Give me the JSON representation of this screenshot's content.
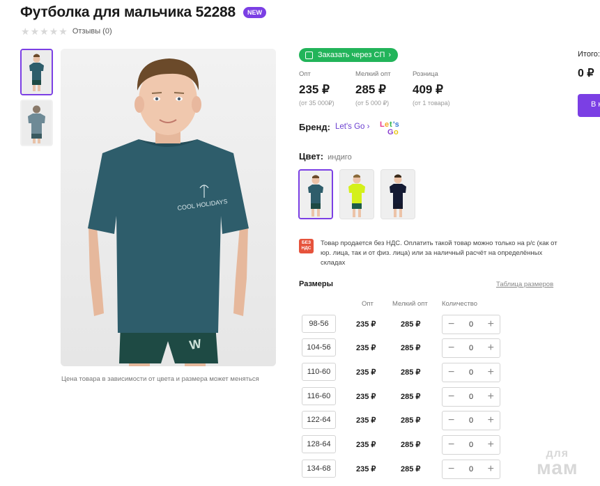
{
  "product": {
    "title": "Футболка для мальчика 52288",
    "badge": "NEW",
    "rating_stars": 0,
    "reviews_label": "Отзывы (0)",
    "caption": "Цена товара в зависимости от цвета и размера может меняться",
    "images": [
      "indigo-front",
      "indigo-back"
    ]
  },
  "order_button": {
    "label": "Заказать через СП"
  },
  "prices": [
    {
      "label": "Опт",
      "value": "235 ₽",
      "note": "(от 35 000₽)"
    },
    {
      "label": "Мелкий опт",
      "value": "285 ₽",
      "note": "(от 5 000 ₽)"
    },
    {
      "label": "Розница",
      "value": "409 ₽",
      "note": "(от 1 товара)"
    }
  ],
  "brand": {
    "label": "Бренд:",
    "name": "Let's Go",
    "logo_text": "Let's Go"
  },
  "color": {
    "label": "Цвет:",
    "value": "индиго",
    "swatches": [
      {
        "name": "indigo",
        "shirt": "#2e5d6b",
        "shorts": "#1e4a44"
      },
      {
        "name": "lime",
        "shirt": "#d4f01a",
        "shorts": "#1c5c4a"
      },
      {
        "name": "navy",
        "shirt": "#141a33",
        "shorts": "#14182c"
      }
    ]
  },
  "vat": {
    "icon_text_1": "БЕЗ",
    "icon_text_2": "НДС",
    "text": "Товар продается без НДС. Оплатить такой товар можно только на р/с (как от юр. лица, так и от физ. лица) или за наличный расчёт на определённых складах"
  },
  "sizes": {
    "title": "Размеры",
    "table_link": "Таблица размеров",
    "headers": {
      "opt": "Опт",
      "small": "Мелкий опт",
      "qty": "Количество"
    },
    "rows": [
      {
        "size": "98-56",
        "opt": "235 ₽",
        "small": "285 ₽",
        "qty": "0"
      },
      {
        "size": "104-56",
        "opt": "235 ₽",
        "small": "285 ₽",
        "qty": "0"
      },
      {
        "size": "110-60",
        "opt": "235 ₽",
        "small": "285 ₽",
        "qty": "0"
      },
      {
        "size": "116-60",
        "opt": "235 ₽",
        "small": "285 ₽",
        "qty": "0"
      },
      {
        "size": "122-64",
        "opt": "235 ₽",
        "small": "285 ₽",
        "qty": "0"
      },
      {
        "size": "128-64",
        "opt": "235 ₽",
        "small": "285 ₽",
        "qty": "0"
      },
      {
        "size": "134-68",
        "opt": "235 ₽",
        "small": "285 ₽",
        "qty": "0"
      }
    ]
  },
  "summary": {
    "total_label": "Итого:",
    "total_value": "0 ₽",
    "buy_label": "В корзину"
  },
  "watermark": {
    "line1": "для",
    "line2": "мам"
  },
  "colors": {
    "accent": "#7b3fe4",
    "green": "#22b45a",
    "vat": "#e6533c"
  }
}
